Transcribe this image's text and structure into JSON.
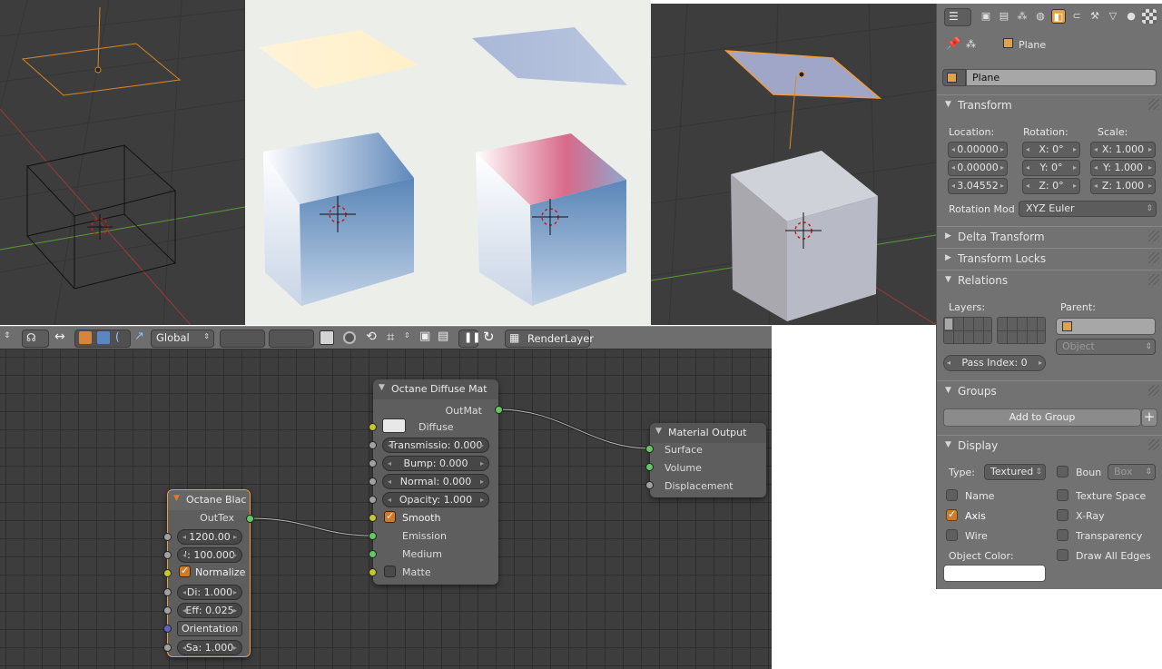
{
  "header": {
    "orientation_menu": "Global",
    "render_layer": "RenderLayer"
  },
  "nodes": {
    "blackbody": {
      "title": "Octane Blac",
      "output": "OutTex",
      "temperature": "1200.00",
      "power": "': 100.000",
      "normalize_label": "Normalize",
      "distribution": "Di: 1.000",
      "efficiency": "Eff: 0.025",
      "orientation": "Orientation",
      "sampling": "Sa: 1.000"
    },
    "diffuse": {
      "title": "Octane Diffuse Mat",
      "output": "OutMat",
      "diffuse_label": "Diffuse",
      "transmission": "Transmissio: 0.000",
      "bump": "Bump: 0.000",
      "normal": "Normal: 0.000",
      "opacity": "Opacity: 1.000",
      "smooth_label": "Smooth",
      "emission_label": "Emission",
      "medium_label": "Medium",
      "matte_label": "Matte"
    },
    "output": {
      "title": "Material Output",
      "surface": "Surface",
      "volume": "Volume",
      "displacement": "Displacement"
    }
  },
  "properties": {
    "breadcrumb_object": "Plane",
    "object_name": "Plane",
    "transform": {
      "title": "Transform",
      "location_label": "Location:",
      "rotation_label": "Rotation:",
      "scale_label": "Scale:",
      "location": [
        "0.00000",
        "0.00000",
        "3.04552"
      ],
      "rotation": [
        "X: 0°",
        "Y: 0°",
        "Z: 0°"
      ],
      "scale": [
        "X: 1.000",
        "Y: 1.000",
        "Z: 1.000"
      ],
      "rotation_mode_label": "Rotation Mod",
      "rotation_mode": "XYZ Euler"
    },
    "delta_transform": "Delta Transform",
    "transform_locks": "Transform Locks",
    "relations": {
      "title": "Relations",
      "layers_label": "Layers:",
      "parent_label": "Parent:",
      "parent_type": "Object",
      "pass_index": "Pass Index: 0"
    },
    "groups": {
      "title": "Groups",
      "add_to_group": "Add to Group",
      "add_icon": "+"
    },
    "display": {
      "title": "Display",
      "type_label": "Type:",
      "type_value": "Textured",
      "bounds_label": "Boun",
      "bounds_value": "Box",
      "name_label": "Name",
      "texture_space_label": "Texture Space",
      "axis_label": "Axis",
      "xray_label": "X-Ray",
      "wire_label": "Wire",
      "transparency_label": "Transparency",
      "object_color_label": "Object Color:",
      "draw_all_edges_label": "Draw All Edges",
      "object_color": "#ffffff"
    }
  },
  "colors": {
    "accent": "#d07a2a",
    "selection": "#f29b3f",
    "socket_color": "#c7c729",
    "socket_shader": "#63c763"
  }
}
